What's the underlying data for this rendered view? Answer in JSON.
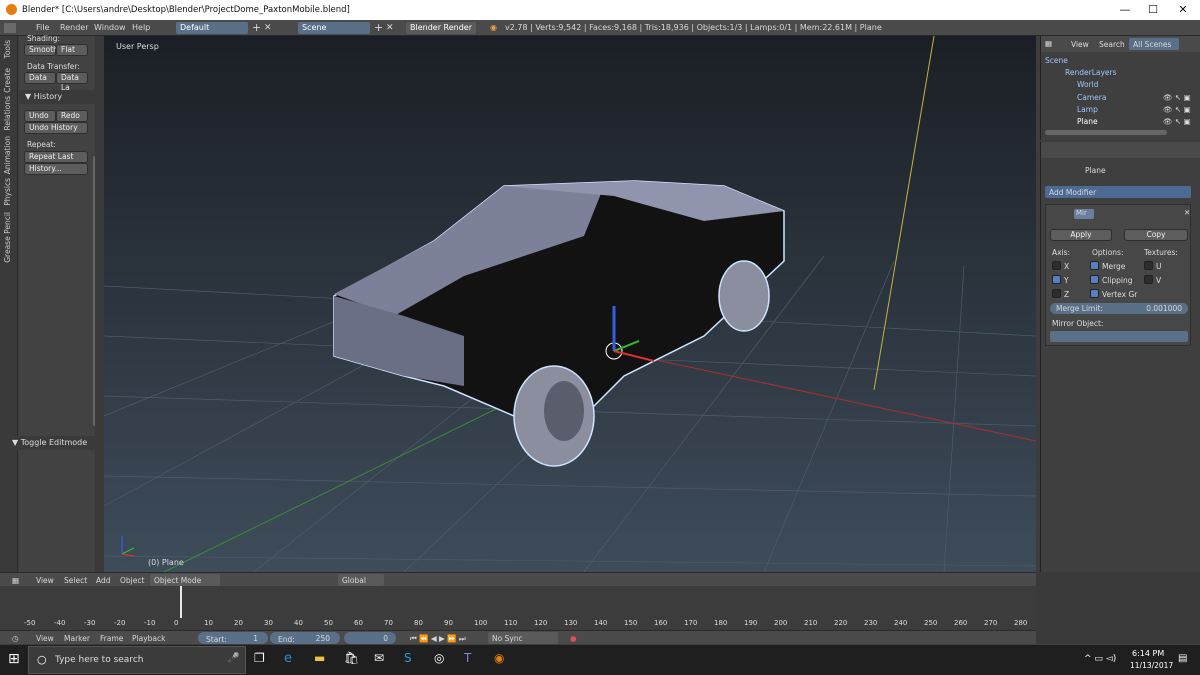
{
  "window": {
    "title": "Blender* [C:\\Users\\andre\\Desktop\\Blender\\ProjectDome_PaxtonMobile.blend]",
    "minimize": "—",
    "maximize": "☐",
    "close": "✕"
  },
  "infobar": {
    "menus": [
      "File",
      "Render",
      "Window",
      "Help"
    ],
    "layout": "Default",
    "scene": "Scene",
    "engine": "Blender Render",
    "stats": "v2.78 | Verts:9,542 | Faces:9,168 | Tris:18,936 | Objects:1/3 | Lamps:0/1 | Mem:22.61M | Plane"
  },
  "tabs": [
    "Tools",
    "Create",
    "Relations",
    "Animation",
    "Physics",
    "Grease Pencil"
  ],
  "toolshelf": {
    "shading_label": "Shading:",
    "smooth": "Smooth",
    "flat": "Flat",
    "data_transfer_label": "Data Transfer:",
    "data": "Data",
    "data_la": "Data La",
    "history_header": "History",
    "undo": "Undo",
    "redo": "Redo",
    "undo_history": "Undo History",
    "repeat_label": "Repeat:",
    "repeat_last": "Repeat Last",
    "history_dots": "History...",
    "toggle_editmode": "Toggle Editmode"
  },
  "viewport": {
    "label": "User Persp",
    "object_label": "(0) Plane"
  },
  "outliner": {
    "tabs": [
      "View",
      "Search",
      "All Scenes"
    ],
    "items": [
      "Scene",
      "RenderLayers",
      "World",
      "Camera",
      "Lamp",
      "Plane"
    ]
  },
  "properties": {
    "object": "Plane",
    "add_modifier": "Add Modifier",
    "modifier_name": "Mir",
    "apply": "Apply",
    "copy": "Copy",
    "axis_label": "Axis:",
    "options_label": "Options:",
    "textures_label": "Textures:",
    "x": "X",
    "y": "Y",
    "z": "Z",
    "merge": "Merge",
    "clipping": "Clipping",
    "vertex_gr": "Vertex Gr",
    "u": "U",
    "v": "V",
    "merge_limit_label": "Merge Limit:",
    "merge_limit_value": "0.001000",
    "mirror_object_label": "Mirror Object:",
    "checks": {
      "x": false,
      "y": true,
      "z": false,
      "merge": true,
      "clipping": true,
      "vertex_gr": true,
      "u": false,
      "v": false
    }
  },
  "view_header": {
    "view": "View",
    "select": "Select",
    "add": "Add",
    "object": "Object",
    "mode": "Object Mode",
    "orientation": "Global"
  },
  "timeline": {
    "ticks": [
      "-50",
      "-40",
      "-30",
      "-20",
      "-10",
      "0",
      "10",
      "20",
      "30",
      "40",
      "50",
      "60",
      "70",
      "80",
      "90",
      "100",
      "110",
      "120",
      "130",
      "140",
      "150",
      "160",
      "170",
      "180",
      "190",
      "200",
      "210",
      "220",
      "230",
      "240",
      "250",
      "260",
      "270",
      "280"
    ]
  },
  "timeline_header": {
    "view": "View",
    "marker": "Marker",
    "frame": "Frame",
    "playback": "Playback",
    "start_label": "Start:",
    "start": "1",
    "end_label": "End:",
    "end": "250",
    "current": "0",
    "sync": "No Sync"
  },
  "taskbar": {
    "search_placeholder": "Type here to search",
    "time": "6:14 PM",
    "date": "11/13/2017"
  }
}
